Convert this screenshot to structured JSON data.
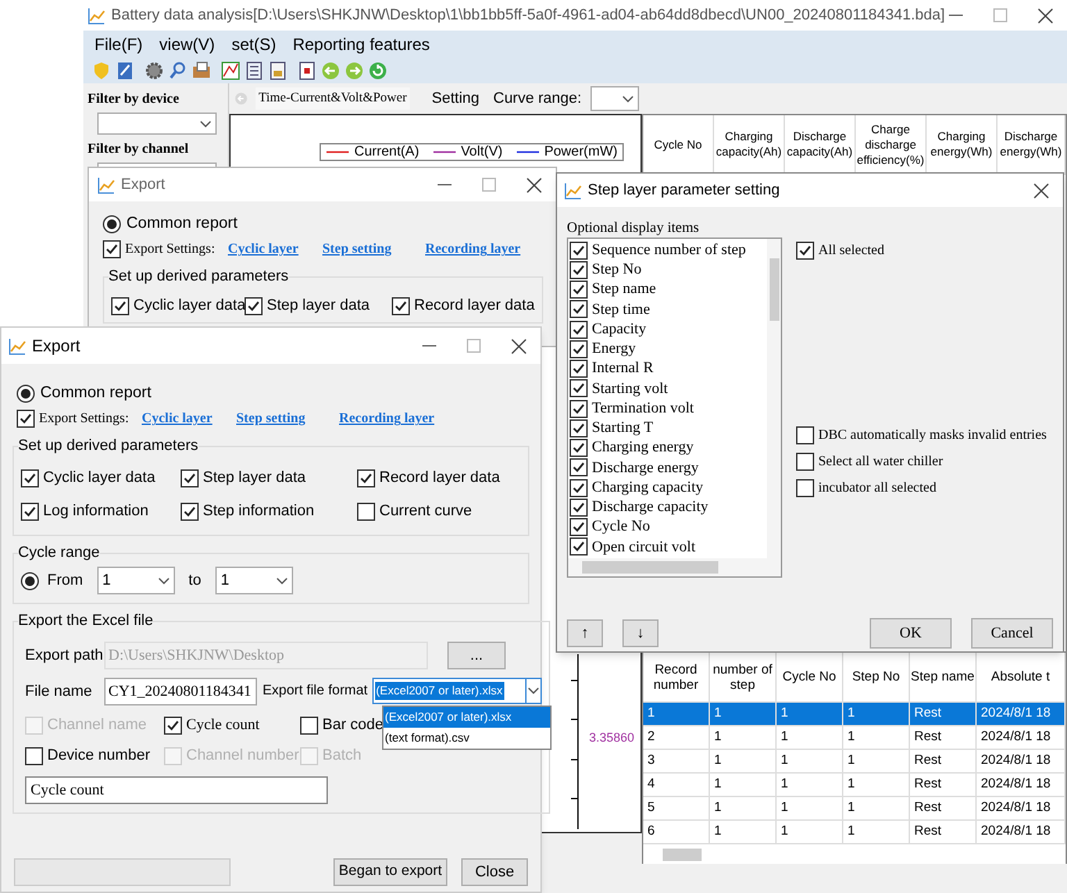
{
  "main_window": {
    "title": "Battery data analysis[D:\\Users\\SHKJNW\\Desktop\\1\\bb1bb5ff-5a0f-4961-ad04-ab64dd8dbecd\\UN00_20240801184341.bda]",
    "menu": [
      "File(F)",
      "view(V)",
      "set(S)",
      "Reporting features"
    ],
    "filters": [
      {
        "label": "Filter by device"
      },
      {
        "label": "Filter by channel"
      }
    ],
    "chart_toolbar": {
      "curve_type": "Time-Current&Volt&Power",
      "setting": "Setting",
      "curve_range_label": "Curve range:"
    },
    "legend": [
      {
        "name": "Current(A)",
        "color": "#e02020"
      },
      {
        "name": "Volt(V)",
        "color": "#a030a0"
      },
      {
        "name": "Power(mW)",
        "color": "#2030e0"
      }
    ],
    "axis_reading": "3.35860",
    "cycle_table": {
      "columns": [
        "Cycle No",
        "Charging capacity(Ah)",
        "Discharge capacity(Ah)",
        "Charge discharge efficiency(%)",
        "Charging energy(Wh)",
        "Discharge energy(Wh)"
      ]
    },
    "record_table": {
      "columns": [
        "Record number",
        "number of step",
        "Cycle No",
        "Step No",
        "Step name",
        "Absolute t"
      ],
      "rows": [
        {
          "cells": [
            "1",
            "1",
            "1",
            "1",
            "Rest",
            "2024/8/1 18"
          ],
          "selected": true
        },
        {
          "cells": [
            "2",
            "1",
            "1",
            "1",
            "Rest",
            "2024/8/1 18"
          ],
          "selected": false
        },
        {
          "cells": [
            "3",
            "1",
            "1",
            "1",
            "Rest",
            "2024/8/1 18"
          ],
          "selected": false
        },
        {
          "cells": [
            "4",
            "1",
            "1",
            "1",
            "Rest",
            "2024/8/1 18"
          ],
          "selected": false
        },
        {
          "cells": [
            "5",
            "1",
            "1",
            "1",
            "Rest",
            "2024/8/1 18"
          ],
          "selected": false
        },
        {
          "cells": [
            "6",
            "1",
            "1",
            "1",
            "Rest",
            "2024/8/1 18"
          ],
          "selected": false
        }
      ]
    }
  },
  "export_back": {
    "title": "Export",
    "report": {
      "label": "Common report",
      "selected": true
    },
    "export_settings": {
      "label": "Export Settings:",
      "checked": true
    },
    "links": [
      "Cyclic layer",
      "Step setting",
      "Recording layer"
    ],
    "derived": {
      "title": "Set up derived parameters",
      "items": [
        {
          "label": "Cyclic layer data",
          "checked": true
        },
        {
          "label": "Step layer data",
          "checked": true
        },
        {
          "label": "Record layer data",
          "checked": true
        }
      ]
    }
  },
  "step_dialog": {
    "title": "Step layer parameter setting",
    "list_title": "Optional display items",
    "items": [
      {
        "label": "Sequence number of step",
        "checked": true
      },
      {
        "label": "Step No",
        "checked": true
      },
      {
        "label": "Step name",
        "checked": true
      },
      {
        "label": "Step time",
        "checked": true
      },
      {
        "label": "Capacity",
        "checked": true
      },
      {
        "label": "Energy",
        "checked": true
      },
      {
        "label": "Internal R",
        "checked": true
      },
      {
        "label": "Starting volt",
        "checked": true
      },
      {
        "label": "Termination volt",
        "checked": true
      },
      {
        "label": "Starting T",
        "checked": true
      },
      {
        "label": "Charging energy",
        "checked": true
      },
      {
        "label": "Discharge energy",
        "checked": true
      },
      {
        "label": "Charging capacity",
        "checked": true
      },
      {
        "label": "Discharge capacity",
        "checked": true
      },
      {
        "label": "Cycle No",
        "checked": true
      },
      {
        "label": "Open circuit volt",
        "checked": true
      }
    ],
    "all_selected": {
      "label": "All selected",
      "checked": true
    },
    "options": [
      {
        "label": "DBC automatically masks invalid entries",
        "checked": false
      },
      {
        "label": "Select all water chiller",
        "checked": false
      },
      {
        "label": "incubator all selected",
        "checked": false
      }
    ],
    "move_buttons": [
      "↑",
      "↓"
    ],
    "buttons": [
      "OK",
      "Cancel"
    ]
  },
  "export_front": {
    "title": "Export",
    "report": {
      "label": "Common report",
      "selected": true
    },
    "export_settings": {
      "label": "Export Settings:",
      "checked": true
    },
    "links": [
      "Cyclic layer",
      "Step setting",
      "Recording layer"
    ],
    "derived": {
      "title": "Set up derived parameters",
      "items": [
        {
          "label": "Cyclic layer data",
          "checked": true
        },
        {
          "label": "Step layer data",
          "checked": true
        },
        {
          "label": "Record layer data",
          "checked": true
        },
        {
          "label": "Log information",
          "checked": true
        },
        {
          "label": "Step information",
          "checked": true
        },
        {
          "label": "Current curve",
          "checked": false
        }
      ]
    },
    "cycle_range": {
      "title": "Cycle range",
      "from_label": "From",
      "from_selected": true,
      "from": "1",
      "to_label": "to",
      "to": "1"
    },
    "excel": {
      "title": "Export the Excel file",
      "path_label": "Export path",
      "path": "D:\\Users\\SHKJNW\\Desktop",
      "browse": "...",
      "name_label": "File name",
      "name": "CY1_20240801184341",
      "format_label": "Export file format",
      "format": "(Excel2007 or later).xlsx",
      "format_options": [
        {
          "label": "(Excel2007 or later).xlsx",
          "selected": true
        },
        {
          "label": "(text format).csv",
          "selected": false
        }
      ],
      "options": [
        {
          "label": "Channel name",
          "checked": false,
          "disabled": true
        },
        {
          "label": "Cycle count",
          "checked": true,
          "disabled": false
        },
        {
          "label": "Bar code",
          "checked": false,
          "disabled": false
        },
        {
          "label": "Device number",
          "checked": false,
          "disabled": false
        },
        {
          "label": "Channel number",
          "checked": false,
          "disabled": true
        },
        {
          "label": "Batch",
          "checked": false,
          "disabled": true
        }
      ],
      "naming": "Cycle count"
    },
    "buttons": [
      "Began to export",
      "Close"
    ]
  }
}
